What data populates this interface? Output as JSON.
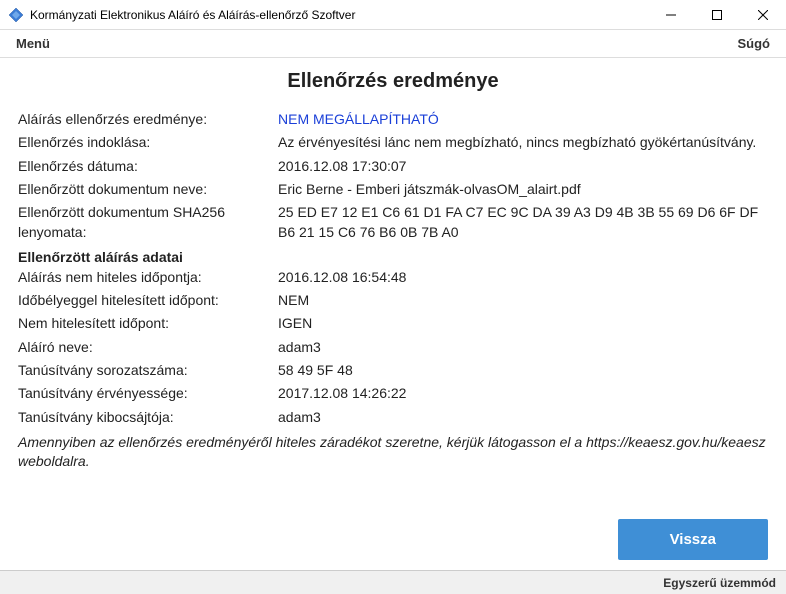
{
  "window": {
    "title": "Kormányzati Elektronikus Aláíró és Aláírás-ellenőrző Szoftver"
  },
  "menubar": {
    "menu": "Menü",
    "help": "Súgó"
  },
  "page": {
    "title": "Ellenőrzés eredménye"
  },
  "rows": {
    "result_label": "Aláírás ellenőrzés eredménye:",
    "result_value": "NEM MEGÁLLAPÍTHATÓ",
    "reason_label": "Ellenőrzés indoklása:",
    "reason_value": "Az érvényesítési lánc nem megbízható, nincs megbízható gyökértanúsítvány.",
    "check_date_label": "Ellenőrzés dátuma:",
    "check_date_value": "2016.12.08 17:30:07",
    "doc_name_label": "Ellenőrzött dokumentum neve:",
    "doc_name_value": "Eric Berne - Emberi játszmák-olvasOM_alairt.pdf",
    "sha_label": "Ellenőrzött dokumentum SHA256 lenyomata:",
    "sha_value": "25 ED E7 12 E1 C6 61 D1 FA C7 EC 9C DA 39 A3 D9 4B 3B 55 69 D6 6F DF B6 21 15 C6 76 B6 0B 7B A0",
    "section_header": "Ellenőrzött aláírás adatai",
    "unauth_time_label": "Aláírás nem hiteles időpontja:",
    "unauth_time_value": "2016.12.08 16:54:48",
    "timestamped_label": "Időbélyeggel hitelesített időpont:",
    "timestamped_value": "NEM",
    "not_auth_time_label": "Nem hitelesített időpont:",
    "not_auth_time_value": "IGEN",
    "signer_label": "Aláíró neve:",
    "signer_value": "adam3",
    "cert_serial_label": "Tanúsítvány sorozatszáma:",
    "cert_serial_value": "58 49 5F 48",
    "cert_validity_label": "Tanúsítvány érvényessége:",
    "cert_validity_value": "2017.12.08 14:26:22",
    "cert_issuer_label": "Tanúsítvány kibocsájtója:",
    "cert_issuer_value": "adam3"
  },
  "footnote": "Amennyiben az ellenőrzés eredményéről hiteles záradékot szeretne, kérjük látogasson el a https://keaesz.gov.hu/keaesz weboldalra.",
  "buttons": {
    "back": "Vissza"
  },
  "statusbar": {
    "mode": "Egyszerű üzemmód"
  }
}
